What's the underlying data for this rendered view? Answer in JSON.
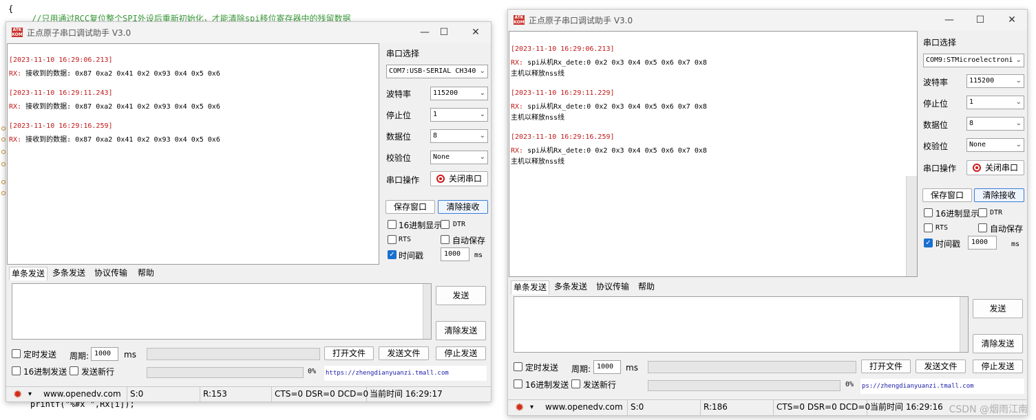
{
  "code": {
    "top_line": "{",
    "comment": "//只用通过RCC复位整个SPI外设后重新初始化，才能清除spi移位寄存器中的残留数据",
    "bottom_line": "printf(\"%#x \",Rx[i]);"
  },
  "left": {
    "title": "正点原子串口调试助手 V3.0",
    "logo": "ATK",
    "receive": [
      {
        "ts": "[2023-11-10 16:29:06.213]",
        "rx": "RX:",
        "text": " 接收到的数据: 0x87 0xa2 0x41 0x2 0x93 0x4 0x5 0x6"
      },
      {
        "ts": "[2023-11-10 16:29:11.243]",
        "rx": "RX:",
        "text": " 接收到的数据: 0x87 0xa2 0x41 0x2 0x93 0x4 0x5 0x6"
      },
      {
        "ts": "[2023-11-10 16:29:16.259]",
        "rx": "RX:",
        "text": " 接收到的数据: 0x87 0xa2 0x41 0x2 0x93 0x4 0x5 0x6"
      }
    ],
    "port_label": "串口选择",
    "port_value": "COM7:USB-SERIAL CH340",
    "baud_label": "波特率",
    "baud_value": "115200",
    "stop_label": "停止位",
    "stop_value": "1",
    "data_label": "数据位",
    "data_value": "8",
    "parity_label": "校验位",
    "parity_value": "None",
    "op_label": "串口操作",
    "close_btn": "关闭串口",
    "save_btn": "保存窗口",
    "clear_recv_btn": "清除接收",
    "hex_display": "16进制显示",
    "dtr": "DTR",
    "rts": "RTS",
    "auto_save": "自动保存",
    "timestamp": "时间戳",
    "ts_value": "1000",
    "ms": "ms",
    "tabs": [
      "单条发送",
      "多条发送",
      "协议传输",
      "帮助"
    ],
    "send_btn": "发送",
    "clear_send_btn": "清除发送",
    "timed_send": "定时发送",
    "period_label": "周期:",
    "period_value": "1000",
    "period_unit": "ms",
    "open_file": "打开文件",
    "send_file": "发送文件",
    "stop_send": "停止发送",
    "hex_send": "16进制发送",
    "newline": "发送新行",
    "percent": "0%",
    "link": "https://zhengdianyuanzi.tmall.com",
    "status": {
      "site": "www.openedv.com",
      "s": "S:0",
      "r": "R:153",
      "lines": "CTS=0 DSR=0 DCD=0",
      "time": "当前时间 16:29:17"
    }
  },
  "right": {
    "title": "正点原子串口调试助手 V3.0",
    "logo": "ATK",
    "receive": [
      {
        "ts": "[2023-11-10 16:29:06.213]",
        "rx": "RX:",
        "text": " spi从机Rx_dete:0 0x2 0x3 0x4 0x5 0x6 0x7 0x8",
        "extra": "主机以释放nss线"
      },
      {
        "ts": "[2023-11-10 16:29:11.229]",
        "rx": "RX:",
        "text": " spi从机Rx_dete:0 0x2 0x3 0x4 0x5 0x6 0x7 0x8",
        "extra": "主机以释放nss线"
      },
      {
        "ts": "[2023-11-10 16:29:16.259]",
        "rx": "RX:",
        "text": " spi从机Rx_dete:0 0x2 0x3 0x4 0x5 0x6 0x7 0x8",
        "extra": "主机以释放nss线"
      }
    ],
    "port_label": "串口选择",
    "port_value": "COM9:STMicroelectroni",
    "baud_label": "波特率",
    "baud_value": "115200",
    "stop_label": "停止位",
    "stop_value": "1",
    "data_label": "数据位",
    "data_value": "8",
    "parity_label": "校验位",
    "parity_value": "None",
    "op_label": "串口操作",
    "close_btn": "关闭串口",
    "save_btn": "保存窗口",
    "clear_recv_btn": "清除接收",
    "hex_display": "16进制显示",
    "dtr": "DTR",
    "rts": "RTS",
    "auto_save": "自动保存",
    "timestamp": "时间戳",
    "ts_value": "1000",
    "ms": "ms",
    "tabs": [
      "单条发送",
      "多条发送",
      "协议传输",
      "帮助"
    ],
    "send_btn": "发送",
    "clear_send_btn": "清除发送",
    "timed_send": "定时发送",
    "period_label": "周期:",
    "period_value": "1000",
    "period_unit": "ms",
    "open_file": "打开文件",
    "send_file": "发送文件",
    "stop_send": "停止发送",
    "hex_send": "16进制发送",
    "newline": "发送新行",
    "percent": "0%",
    "link": "ps://zhengdianyuanzi.tmall.com",
    "status": {
      "site": "www.openedv.com",
      "s": "S:0",
      "r": "R:186",
      "lines": "CTS=0 DSR=0 DCD=0",
      "time": "当前时间 16:29:16"
    }
  },
  "watermark": "CSDN @烟雨江南"
}
